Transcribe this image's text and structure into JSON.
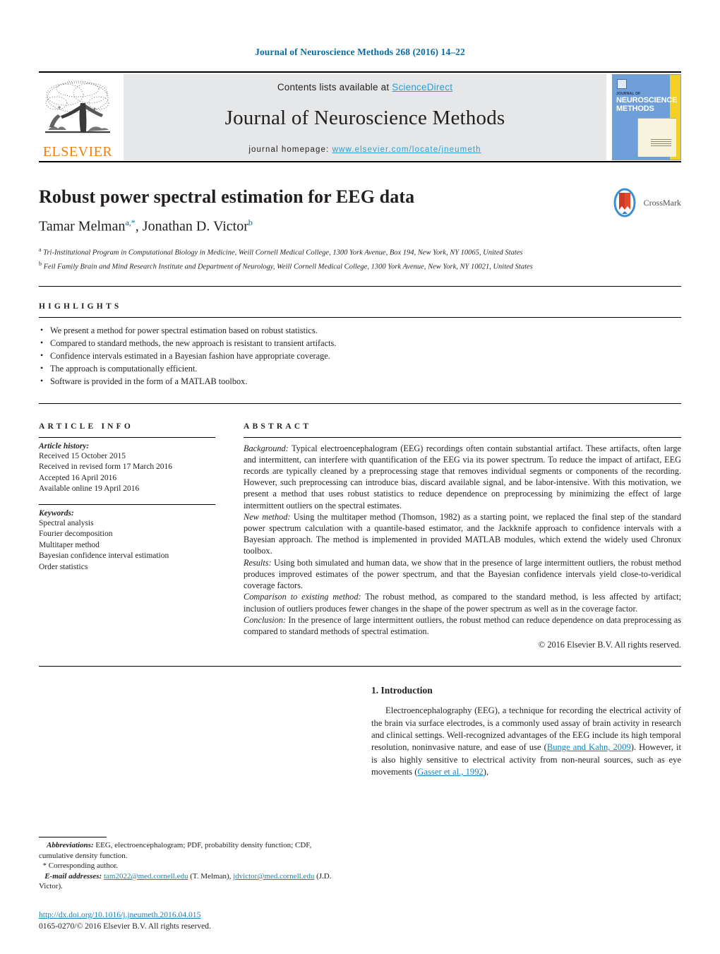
{
  "running_head": "Journal of Neuroscience Methods 268 (2016) 14–22",
  "masthead": {
    "publisher": "ELSEVIER",
    "contents_prefix": "Contents lists available at ",
    "contents_link": "ScienceDirect",
    "journal_title": "Journal of Neuroscience Methods",
    "homepage_prefix": "journal homepage: ",
    "homepage_url": "www.elsevier.com/locate/jneumeth",
    "cover": {
      "line1": "JOURNAL OF",
      "line2": "NEUROSCIENCE",
      "line3": "METHODS"
    }
  },
  "article": {
    "title": "Robust power spectral estimation for EEG data",
    "authors": [
      {
        "name": "Tamar Melman",
        "marks": "a,*"
      },
      {
        "name": "Jonathan D. Victor",
        "marks": "b"
      }
    ],
    "authors_separator": ", ",
    "affiliations": [
      {
        "mark": "a",
        "text": "Tri-Institutional Program in Computational Biology in Medicine, Weill Cornell Medical College, 1300 York Avenue, Box 194, New York, NY 10065, United States"
      },
      {
        "mark": "b",
        "text": "Feil Family Brain and Mind Research Institute and Department of Neurology, Weill Cornell Medical College, 1300 York Avenue, New York, NY 10021, United States"
      }
    ],
    "crossmark_label": "CrossMark"
  },
  "highlights": {
    "heading": "HIGHLIGHTS",
    "items": [
      "We present a method for power spectral estimation based on robust statistics.",
      "Compared to standard methods, the new approach is resistant to transient artifacts.",
      "Confidence intervals estimated in a Bayesian fashion have appropriate coverage.",
      "The approach is computationally efficient.",
      "Software is provided in the form of a MATLAB toolbox."
    ]
  },
  "article_info": {
    "heading": "ARTICLE INFO",
    "history_label": "Article history:",
    "history": [
      "Received 15 October 2015",
      "Received in revised form 17 March 2016",
      "Accepted 16 April 2016",
      "Available online 19 April 2016"
    ],
    "keywords_label": "Keywords:",
    "keywords": [
      "Spectral analysis",
      "Fourier decomposition",
      "Multitaper method",
      "Bayesian confidence interval estimation",
      "Order statistics"
    ]
  },
  "abstract": {
    "heading": "ABSTRACT",
    "sections": [
      {
        "lead": "Background:",
        "text": " Typical electroencephalogram (EEG) recordings often contain substantial artifact. These artifacts, often large and intermittent, can interfere with quantification of the EEG via its power spectrum. To reduce the impact of artifact, EEG records are typically cleaned by a preprocessing stage that removes individual segments or components of the recording. However, such preprocessing can introduce bias, discard available signal, and be labor-intensive. With this motivation, we present a method that uses robust statistics to reduce dependence on preprocessing by minimizing the effect of large intermittent outliers on the spectral estimates."
      },
      {
        "lead": "New method:",
        "text": " Using the multitaper method (Thomson, 1982) as a starting point, we replaced the final step of the standard power spectrum calculation with a quantile-based estimator, and the Jackknife approach to confidence intervals with a Bayesian approach. The method is implemented in provided MATLAB modules, which extend the widely used Chronux toolbox."
      },
      {
        "lead": "Results:",
        "text": " Using both simulated and human data, we show that in the presence of large intermittent outliers, the robust method produces improved estimates of the power spectrum, and that the Bayesian confidence intervals yield close-to-veridical coverage factors."
      },
      {
        "lead": "Comparison to existing method:",
        "text": " The robust method, as compared to the standard method, is less affected by artifact; inclusion of outliers produces fewer changes in the shape of the power spectrum as well as in the coverage factor."
      },
      {
        "lead": "Conclusion:",
        "text": " In the presence of large intermittent outliers, the robust method can reduce dependence on data preprocessing as compared to standard methods of spectral estimation."
      }
    ],
    "copyright": "© 2016 Elsevier B.V. All rights reserved."
  },
  "body": {
    "section_number_title": "1. Introduction",
    "paragraph_parts": [
      {
        "type": "text",
        "value": "Electroencephalography (EEG), a technique for recording the electrical activity of the brain via surface electrodes, is a commonly used assay of brain activity in research and clinical settings. Well-recognized advantages of the EEG include its high temporal resolution, noninvasive nature, and ease of use ("
      },
      {
        "type": "cite",
        "value": "Bunge and Kahn, 2009"
      },
      {
        "type": "text",
        "value": "). However, it is also highly sensitive to electrical activity from non-neural sources, such as eye movements ("
      },
      {
        "type": "cite",
        "value": "Gasser et al., 1992"
      },
      {
        "type": "text",
        "value": "),"
      }
    ]
  },
  "footnotes": {
    "abbreviations_label": "Abbreviations:",
    "abbreviations_text": " EEG, electroencephalogram; PDF, probability density function; CDF, cumulative density function.",
    "corresponding_author": "* Corresponding author.",
    "email_label": "E-mail addresses:",
    "emails": [
      {
        "address": "tam2022@med.cornell.edu",
        "owner": " (T. Melman), "
      },
      {
        "address": "jdvictor@med.cornell.edu",
        "owner": " (J.D. Victor)."
      }
    ],
    "doi": "http://dx.doi.org/10.1016/j.jneumeth.2016.04.015",
    "issn_line": "0165-0270/© 2016 Elsevier B.V. All rights reserved."
  },
  "colors": {
    "link_blue": "#2a9fd6",
    "cite_blue": "#1b7fb5",
    "running_head_blue": "#0b6ca0",
    "elsevier_orange": "#f07f13",
    "masthead_grey": "#e6e7e8"
  }
}
